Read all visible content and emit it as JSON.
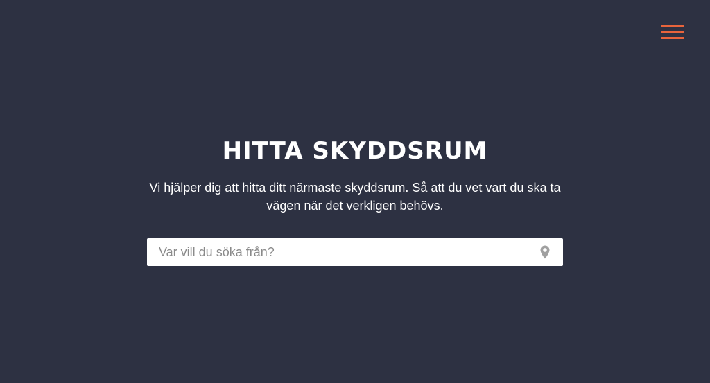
{
  "header": {
    "menu_icon": "hamburger-menu-icon",
    "accent_color": "#e8643c"
  },
  "hero": {
    "title": "HITTA SKYDDSRUM",
    "subtitle": "Vi hjälper dig att hitta ditt närmaste skyddsrum. Så att du vet vart du ska ta vägen när det verkligen behövs."
  },
  "search": {
    "placeholder": "Var vill du söka från?",
    "value": "",
    "location_icon": "map-pin-icon"
  },
  "colors": {
    "background": "#2d3142",
    "text": "#ffffff",
    "input_background": "#ffffff",
    "icon_gray": "#a0a0a0"
  }
}
